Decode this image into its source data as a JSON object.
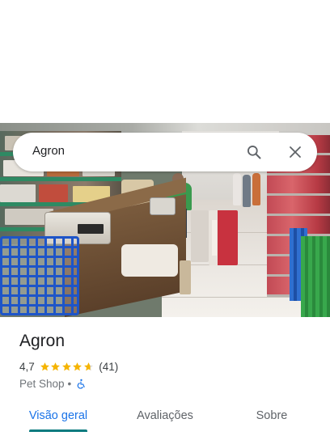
{
  "search": {
    "query": "Agron",
    "search_icon": "search-icon",
    "clear_icon": "close-icon"
  },
  "place": {
    "name": "Agron",
    "rating": "4,7",
    "rating_value": 4.7,
    "stars_max": 5,
    "review_count": "(41)",
    "category": "Pet Shop",
    "separator": "•",
    "accessibility_icon": "wheelchair-icon"
  },
  "tabs": [
    {
      "label": "Visão geral",
      "active": true
    },
    {
      "label": "Avaliações",
      "active": false
    },
    {
      "label": "Sobre",
      "active": false
    }
  ],
  "colors": {
    "star": "#f5b400",
    "star_empty": "#dadce0",
    "tab_active": "#1a73e8",
    "tab_indicator": "#0b7b7f",
    "accessibility": "#1a73e8"
  }
}
